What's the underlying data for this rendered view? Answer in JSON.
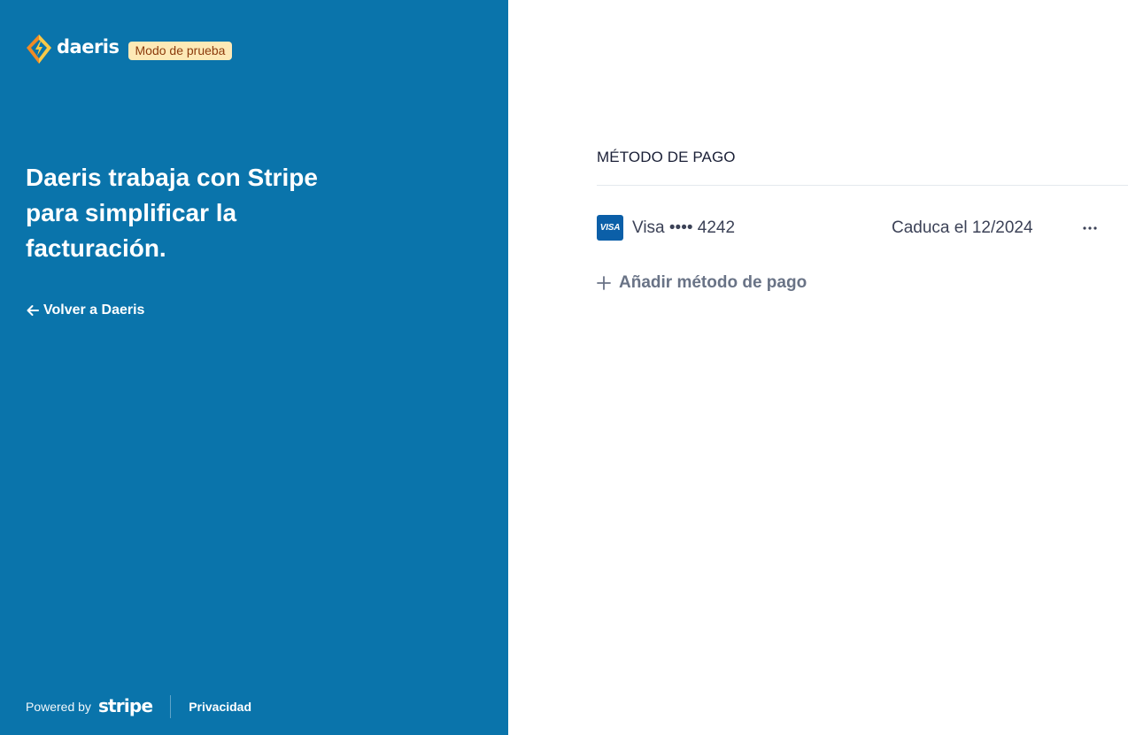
{
  "brand": {
    "name": "daeris",
    "test_mode_label": "Modo de prueba",
    "logo_icon": "lightning-diamond-logo",
    "colors": {
      "panel_bg": "#0a74ab",
      "badge_bg": "#fde9b6",
      "badge_text": "#8c3b0c",
      "logo_orange": "#f08a24",
      "logo_yellow": "#f7c948"
    }
  },
  "intro": {
    "headline": "Daeris trabaja con Stripe para simplificar la facturación.",
    "back_link_label": "Volver a Daeris",
    "back_icon": "arrow-left-icon"
  },
  "footer": {
    "powered_by_label": "Powered by",
    "stripe_label": "stripe",
    "privacy_label": "Privacidad"
  },
  "payment_methods": {
    "section_title": "MÉTODO DE PAGO",
    "cards": [
      {
        "brand_badge": "VISA",
        "label": "Visa •••• 4242",
        "expiry": "Caduca el 12/2024",
        "menu_icon": "more-horizontal-icon"
      }
    ],
    "add_label": "Añadir método de pago",
    "add_icon": "plus-icon"
  }
}
